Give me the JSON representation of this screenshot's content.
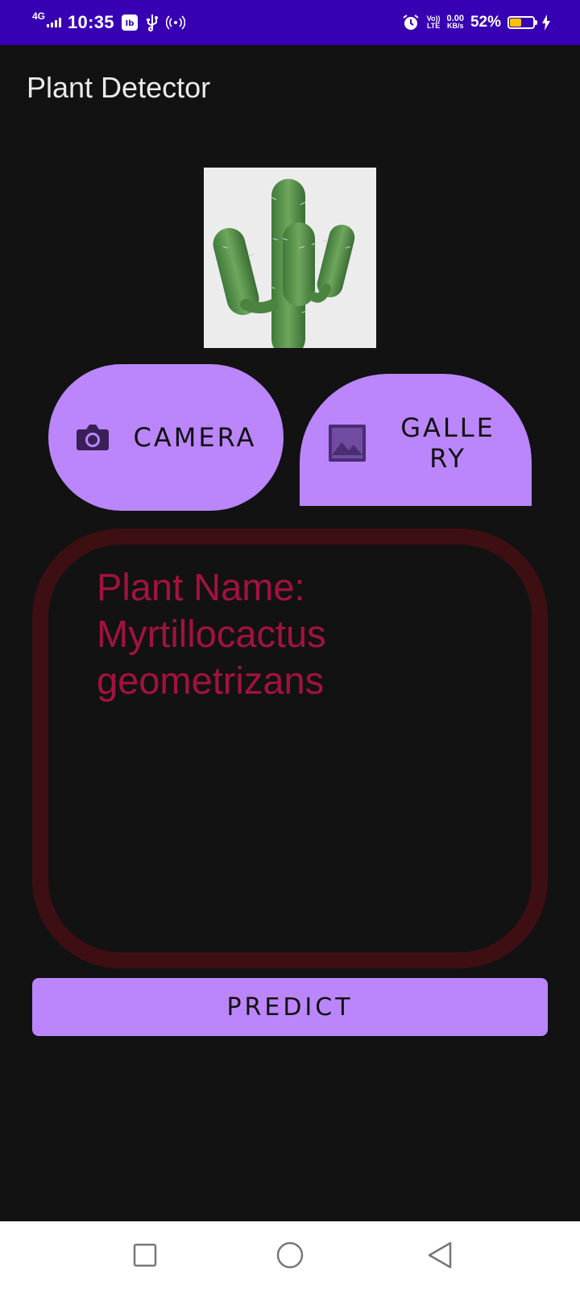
{
  "status_bar": {
    "network": "4G",
    "time": "10:35",
    "volte": "Vo))",
    "lte": "LTE",
    "speed_value": "0.00",
    "speed_unit": "KB/s",
    "battery_percent": "52%",
    "battery_level": 0.52,
    "battery_color": "#ffc107"
  },
  "app": {
    "title": "Plant Detector"
  },
  "buttons": {
    "camera_label": "CAMERA",
    "gallery_label": "GALLERY",
    "predict_label": "PREDICT",
    "accent_color": "#bb86fc"
  },
  "result": {
    "text": "Plant Name: Myrtillocactus geometrizans",
    "text_color": "#a3123f",
    "border_color": "#3e0f12"
  },
  "icons": {
    "camera": "camera-icon",
    "gallery": "image-icon",
    "nav_recents": "square-icon",
    "nav_home": "circle-icon",
    "nav_back": "triangle-back-icon"
  }
}
